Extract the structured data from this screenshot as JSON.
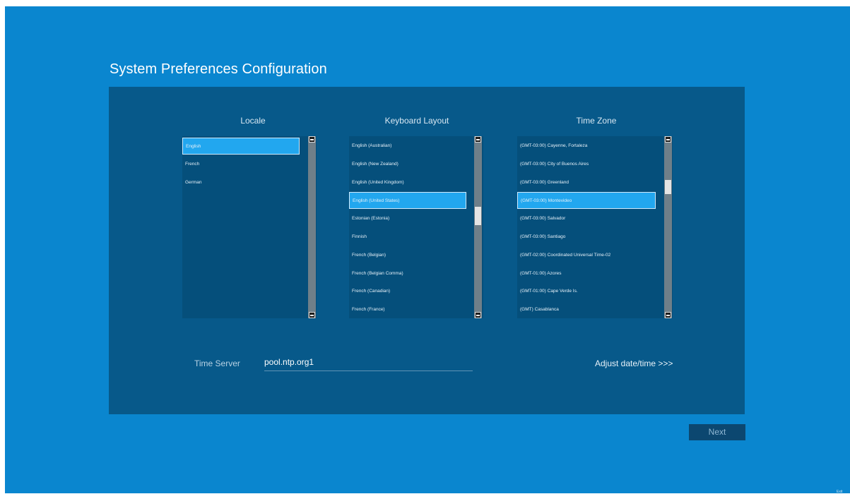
{
  "page": {
    "title": "System Preferences Configuration"
  },
  "locale": {
    "header": "Locale",
    "items": [
      {
        "label": "English",
        "selected": true
      },
      {
        "label": "French",
        "selected": false
      },
      {
        "label": "German",
        "selected": false
      }
    ]
  },
  "keyboard": {
    "header": "Keyboard Layout",
    "items": [
      {
        "label": "English (Australian)",
        "selected": false
      },
      {
        "label": "English (New Zealand)",
        "selected": false
      },
      {
        "label": "English (United Kingdom)",
        "selected": false
      },
      {
        "label": "English (United States)",
        "selected": true
      },
      {
        "label": "Estonian (Estonia)",
        "selected": false
      },
      {
        "label": "Finnish",
        "selected": false
      },
      {
        "label": "French (Belgian)",
        "selected": false
      },
      {
        "label": "French (Belgian Comma)",
        "selected": false
      },
      {
        "label": "French (Canadian)",
        "selected": false
      },
      {
        "label": "French (France)",
        "selected": false
      }
    ]
  },
  "timezone": {
    "header": "Time Zone",
    "items": [
      {
        "label": "(GMT-03:00) Cayenne, Fortaleza",
        "selected": false
      },
      {
        "label": "(GMT-03:00) City of Buenos Aires",
        "selected": false
      },
      {
        "label": "(GMT-03:00) Greenland",
        "selected": false
      },
      {
        "label": "(GMT-03:00) Montevideo",
        "selected": true
      },
      {
        "label": "(GMT-03:00) Salvador",
        "selected": false
      },
      {
        "label": "(GMT-03:00) Santiago",
        "selected": false
      },
      {
        "label": "(GMT-02:00) Coordinated Universal Time-02",
        "selected": false
      },
      {
        "label": "(GMT-01:00) Azores",
        "selected": false
      },
      {
        "label": "(GMT-01:00) Cape Verde Is.",
        "selected": false
      },
      {
        "label": "(GMT) Casablanca",
        "selected": false
      }
    ]
  },
  "time_server": {
    "label": "Time Server",
    "value": "pool.ntp.org1"
  },
  "adjust_link": "Adjust date/time >>>",
  "next_button": "Next",
  "exit_label": "Exit",
  "colors": {
    "background": "#0a86cf",
    "panel": "#07598a",
    "list": "#054f7b",
    "selection": "#22a7ef"
  }
}
